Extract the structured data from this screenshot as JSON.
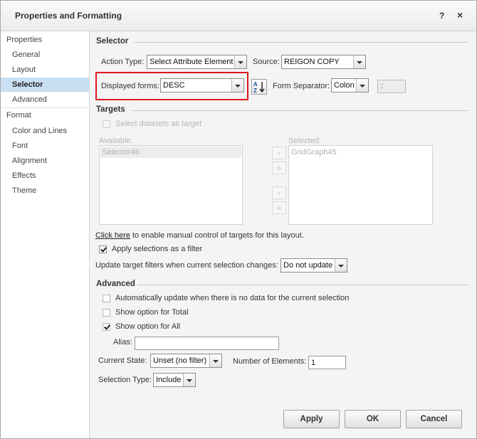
{
  "dialog": {
    "title": "Properties and Formatting",
    "help_label": "?",
    "close_label": "×"
  },
  "sidebar": {
    "categories": [
      "Properties",
      "Format"
    ],
    "properties_items": [
      "General",
      "Layout",
      "Selector",
      "Advanced"
    ],
    "format_items": [
      "Color and Lines",
      "Font",
      "Alignment",
      "Effects",
      "Theme"
    ],
    "selected": "Selector"
  },
  "selector": {
    "section_title": "Selector",
    "action_type_label": "Action Type:",
    "action_type_value": "Select Attribute Element",
    "source_label": "Source:",
    "source_value": "REIGON COPY",
    "displayed_forms_label": "Displayed forms:",
    "displayed_forms_value": "DESC",
    "form_separator_label": "Form Separator:",
    "form_separator_value": "Colon",
    "separator_char": ":"
  },
  "targets": {
    "section_title": "Targets",
    "select_datasets_label": "Select datasets as target",
    "available_label": "Available:",
    "available_items": [
      "Selector46"
    ],
    "selected_label": "Selected:",
    "selected_items": [
      "GridGraph45"
    ],
    "link_text": "Click here",
    "link_suffix": " to enable manual control of targets for this layout.",
    "apply_filter_label": "Apply selections as a filter",
    "apply_filter_checked": true,
    "update_label": "Update target filters when current selection changes:",
    "update_value": "Do not update"
  },
  "advanced": {
    "section_title": "Advanced",
    "auto_update_label": "Automatically update when there is no data for the current selection",
    "show_total_label": "Show option for Total",
    "show_all_label": "Show option for All",
    "show_all_checked": true,
    "alias_label": "Alias:",
    "alias_value": "",
    "current_state_label": "Current State:",
    "current_state_value": "Unset (no filter)",
    "num_elements_label": "Number of Elements:",
    "num_elements_value": "1",
    "selection_type_label": "Selection Type:",
    "selection_type_value": "Include"
  },
  "footer": {
    "apply_label": "Apply",
    "ok_label": "OK",
    "cancel_label": "Cancel"
  },
  "colors": {
    "highlight_border": "#e0141e",
    "selected_sidebar": "#c9dff2"
  }
}
